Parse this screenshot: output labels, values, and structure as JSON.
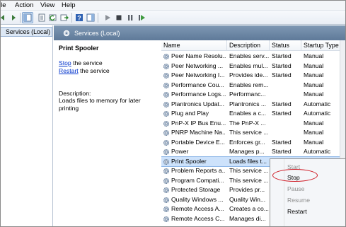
{
  "menu": {
    "items": [
      "ile",
      "Action",
      "View",
      "Help"
    ]
  },
  "toolbar": {
    "buttons": [
      "back-icon",
      "forward-icon",
      "show-hide-tree-icon",
      "properties-icon",
      "refresh-icon",
      "export-icon",
      "help-icon",
      "show-action-pane-icon",
      "start-icon",
      "stop-icon",
      "pause-icon",
      "restart-icon"
    ]
  },
  "tree": {
    "selected": "Services (Local)"
  },
  "panel": {
    "header": "Services (Local)"
  },
  "details": {
    "title": "Print Spooler",
    "stop_link": "Stop",
    "stop_rest": " the service",
    "restart_link": "Restart",
    "restart_rest": " the service",
    "desc_label": "Description:",
    "desc_text_1": "Loads files to memory for later",
    "desc_text_2": "printing"
  },
  "table": {
    "columns": [
      "Name",
      "Description",
      "Status",
      "Startup Type"
    ],
    "rows": [
      {
        "name": "Peer Name Resolu...",
        "desc": "Enables serv...",
        "status": "Started",
        "startup": "Manual"
      },
      {
        "name": "Peer Networking ...",
        "desc": "Enables mul...",
        "status": "Started",
        "startup": "Manual"
      },
      {
        "name": "Peer Networking I...",
        "desc": "Provides ide...",
        "status": "Started",
        "startup": "Manual"
      },
      {
        "name": "Performance Cou...",
        "desc": "Enables rem...",
        "status": "",
        "startup": "Manual"
      },
      {
        "name": "Performance Logs...",
        "desc": "Performanc...",
        "status": "",
        "startup": "Manual"
      },
      {
        "name": "Plantronics Updat...",
        "desc": "Plantronics ...",
        "status": "Started",
        "startup": "Automatic"
      },
      {
        "name": "Plug and Play",
        "desc": "Enables a c...",
        "status": "Started",
        "startup": "Automatic"
      },
      {
        "name": "PnP-X IP Bus Enu...",
        "desc": "The PnP-X ...",
        "status": "",
        "startup": "Manual"
      },
      {
        "name": "PNRP Machine Na...",
        "desc": "This service ...",
        "status": "",
        "startup": "Manual"
      },
      {
        "name": "Portable Device E...",
        "desc": "Enforces gr...",
        "status": "Started",
        "startup": "Manual"
      },
      {
        "name": "Power",
        "desc": "Manages p...",
        "status": "Started",
        "startup": "Automatic"
      },
      {
        "name": "Print Spooler",
        "desc": "Loads files t...",
        "status": "",
        "startup": ""
      },
      {
        "name": "Problem Reports a...",
        "desc": "This service ...",
        "status": "",
        "startup": ""
      },
      {
        "name": "Program Compati...",
        "desc": "This service ...",
        "status": "",
        "startup": ""
      },
      {
        "name": "Protected Storage",
        "desc": "Provides pr...",
        "status": "",
        "startup": ""
      },
      {
        "name": "Quality Windows ...",
        "desc": "Quality Win...",
        "status": "",
        "startup": ""
      },
      {
        "name": "Remote Access A...",
        "desc": "Creates a co...",
        "status": "",
        "startup": ""
      },
      {
        "name": "Remote Access C...",
        "desc": "Manages di...",
        "status": "",
        "startup": ""
      }
    ],
    "selected_index": 11
  },
  "context_menu": {
    "start": "Start",
    "stop": "Stop",
    "pause": "Pause",
    "resume": "Resume",
    "restart": "Restart"
  },
  "colors": {
    "header_bg": "#6a84a3",
    "selection": "#cde2fb",
    "link": "#0033cc",
    "highlight_ring": "#d0202a"
  }
}
